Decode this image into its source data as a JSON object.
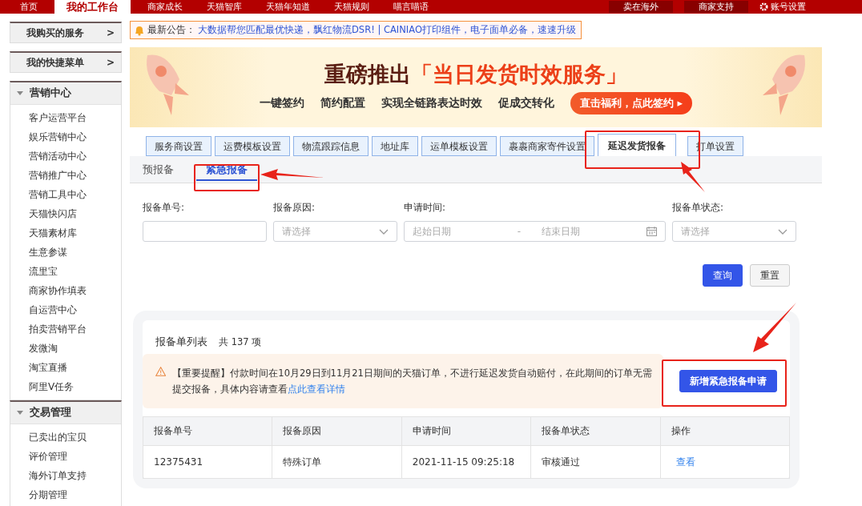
{
  "top_nav": {
    "items": [
      {
        "label": "首页",
        "selected": false
      },
      {
        "label": "我的工作台",
        "selected": true
      },
      {
        "label": "商家成长",
        "selected": false
      },
      {
        "label": "天猫智库",
        "selected": false
      },
      {
        "label": "天猫年知道",
        "selected": false
      },
      {
        "label": "天猫规则",
        "selected": false
      },
      {
        "label": "喵言喵语",
        "selected": false
      }
    ],
    "right_items": [
      {
        "label": "卖在海外",
        "kind": "dropdown"
      },
      {
        "label": "商家支持",
        "kind": "dropdown"
      },
      {
        "label": "账号设置",
        "kind": "settings"
      }
    ]
  },
  "sidebar": {
    "shortcuts": [
      "我购买的服务",
      "我的快捷菜单"
    ],
    "arrow": ">",
    "groups": [
      {
        "title": "营销中心",
        "expanded": true,
        "items": [
          "客户运营平台",
          "娱乐营销中心",
          "营销活动中心",
          "营销推广中心",
          "营销工具中心",
          "天猫快闪店",
          "天猫素材库",
          "生意参谋",
          "流里宝",
          "商家协作填表",
          "自运营中心",
          "拍卖营销平台",
          "发微淘",
          "淘宝直播",
          "阿里V任务"
        ]
      },
      {
        "title": "交易管理",
        "expanded": true,
        "items": [
          "已卖出的宝贝",
          "评价管理",
          "海外订单支持",
          "分期管理"
        ]
      }
    ]
  },
  "notice": {
    "label": "最新公告：",
    "text": "大数据帮您匹配最优快递，飘红物流DSR! | CAINIAO打印组件，电子面单必备，速速升级"
  },
  "banner": {
    "title": "重磅推出",
    "highlight": "「当日发货时效服务」",
    "points": [
      "一键签约",
      "简约配置",
      "实现全链路表达时效",
      "促成交转化"
    ],
    "button": "直击福利，点此签约 ▸"
  },
  "tabs": [
    {
      "label": "服务商设置",
      "selected": false
    },
    {
      "label": "运费模板设置",
      "selected": false
    },
    {
      "label": "物流跟踪信息",
      "selected": false
    },
    {
      "label": "地址库",
      "selected": false
    },
    {
      "label": "运单模板设置",
      "selected": false
    },
    {
      "label": "裹裹商家寄件设置",
      "selected": false
    },
    {
      "label": "延迟发货报备",
      "selected": true
    },
    {
      "label": "打单设置",
      "selected": false
    }
  ],
  "sub_tabs": [
    {
      "label": "预报备",
      "selected": false
    },
    {
      "label": "紧急报备",
      "selected": true
    }
  ],
  "filters": [
    {
      "label": "报备单号:",
      "kind": "input"
    },
    {
      "label": "报备原因:",
      "kind": "select",
      "placeholder": "请选择"
    },
    {
      "label": "申请时间:",
      "kind": "daterange",
      "start_placeholder": "起始日期",
      "separator": "-",
      "end_placeholder": "结束日期"
    },
    {
      "label": "报备单状态:",
      "kind": "select",
      "placeholder": "请选择"
    }
  ],
  "buttons": {
    "search": "查询",
    "reset": "重置"
  },
  "list": {
    "title": "报备单列表",
    "count": "共 137 项",
    "alert": {
      "text": "【重要提醒】付款时间在10月29日到11月21日期间的天猫订单，不进行延迟发货自动赔付，在此期间的订单无需提交报备，具体内容请查看",
      "link": "点此查看详情"
    },
    "add_button": "新增紧急报备申请",
    "table": {
      "columns": [
        "报备单号",
        "报备原因",
        "申请时间",
        "报备单状态",
        "操作"
      ],
      "rows": [
        {
          "cells": [
            "12375431",
            "特殊订单",
            "2021-11-15 09:25:18",
            "审核通过"
          ],
          "action": "查看"
        }
      ]
    }
  }
}
